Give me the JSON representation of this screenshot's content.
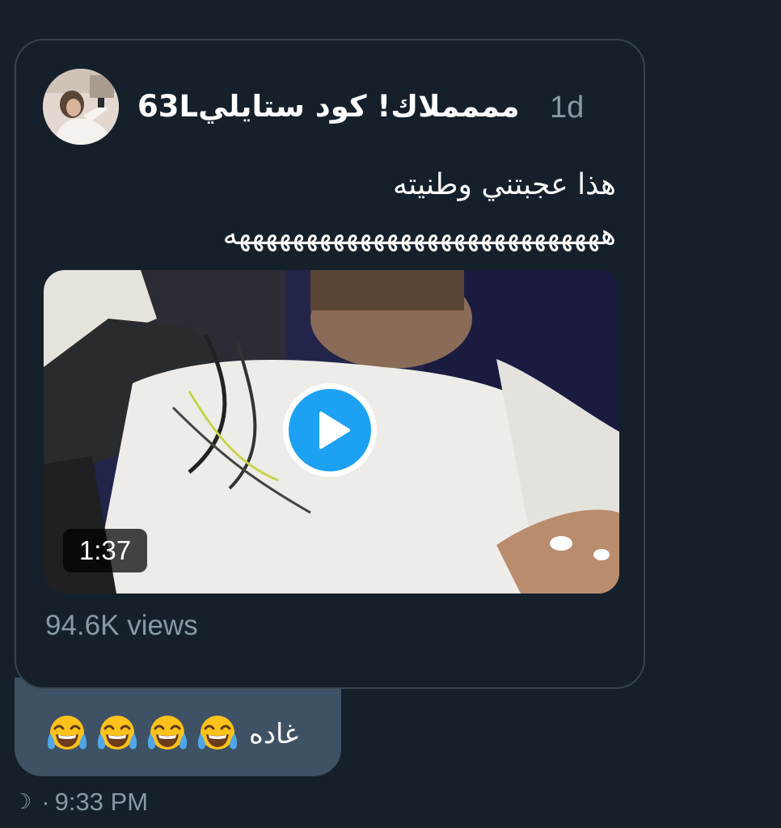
{
  "quoted_tweet": {
    "author_name": "مممملاك! كود ستايلي63L",
    "time": "1d",
    "text_lines": [
      "هذا عجبتني وطنيته",
      "ههههههههههههههههههههههههههههه"
    ],
    "video": {
      "duration": "1:37",
      "play_icon": "play-icon"
    },
    "views": "94.6K views"
  },
  "reply": {
    "text": "غاده",
    "emoji": "face-with-tears-of-joy",
    "emoji_count": 4
  },
  "meta": {
    "status_icon": "moon-icon",
    "separator": "·",
    "time": "9:33 PM"
  },
  "colors": {
    "background": "#15202b",
    "border": "#38444d",
    "secondary_text": "#8899a6",
    "bubble": "#3e5165",
    "accent": "#1da1f2"
  }
}
